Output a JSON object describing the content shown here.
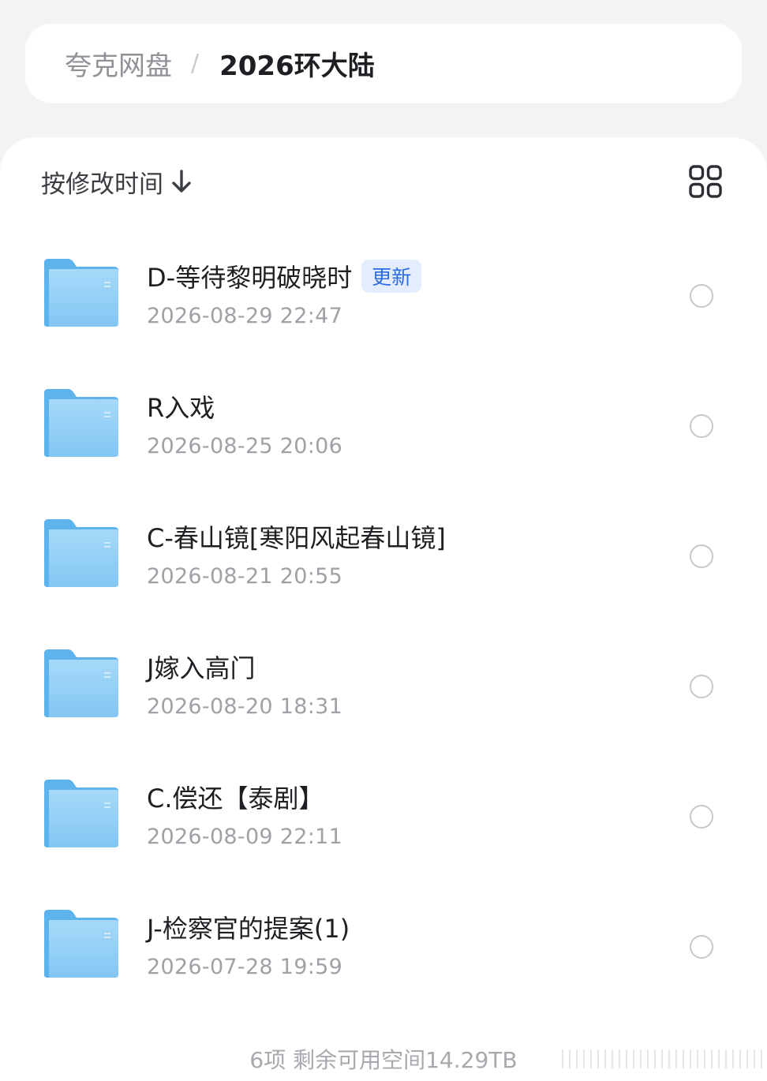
{
  "breadcrumb": {
    "root": "夸克网盘",
    "separator": "/",
    "current": "2026环大陆"
  },
  "toolbar": {
    "sort_label": "按修改时间",
    "sort_icon": "arrow-down-icon",
    "view_toggle_icon": "grid-view-icon"
  },
  "files": [
    {
      "name": "D-等待黎明破晓时",
      "badge": "更新",
      "date": "2026-08-29 22:47"
    },
    {
      "name": "R入戏",
      "date": "2026-08-25 20:06"
    },
    {
      "name": "C-春山镜[寒阳风起春山镜]",
      "date": "2026-08-21 20:55"
    },
    {
      "name": "J嫁入高门",
      "date": "2026-08-20 18:31"
    },
    {
      "name": "C.偿还【泰剧】",
      "date": "2026-08-09 22:11"
    },
    {
      "name": "J-检察官的提案(1)",
      "date": "2026-07-28 19:59"
    }
  ],
  "footer": {
    "summary": "6项 剩余可用空间14.29TB"
  },
  "colors": {
    "background": "#f2f3f5",
    "card": "#ffffff",
    "badge_bg": "#e3edfd",
    "badge_text": "#2a6be6",
    "folder_light": "#9fd4f6",
    "folder_dark": "#5cb2ec"
  }
}
